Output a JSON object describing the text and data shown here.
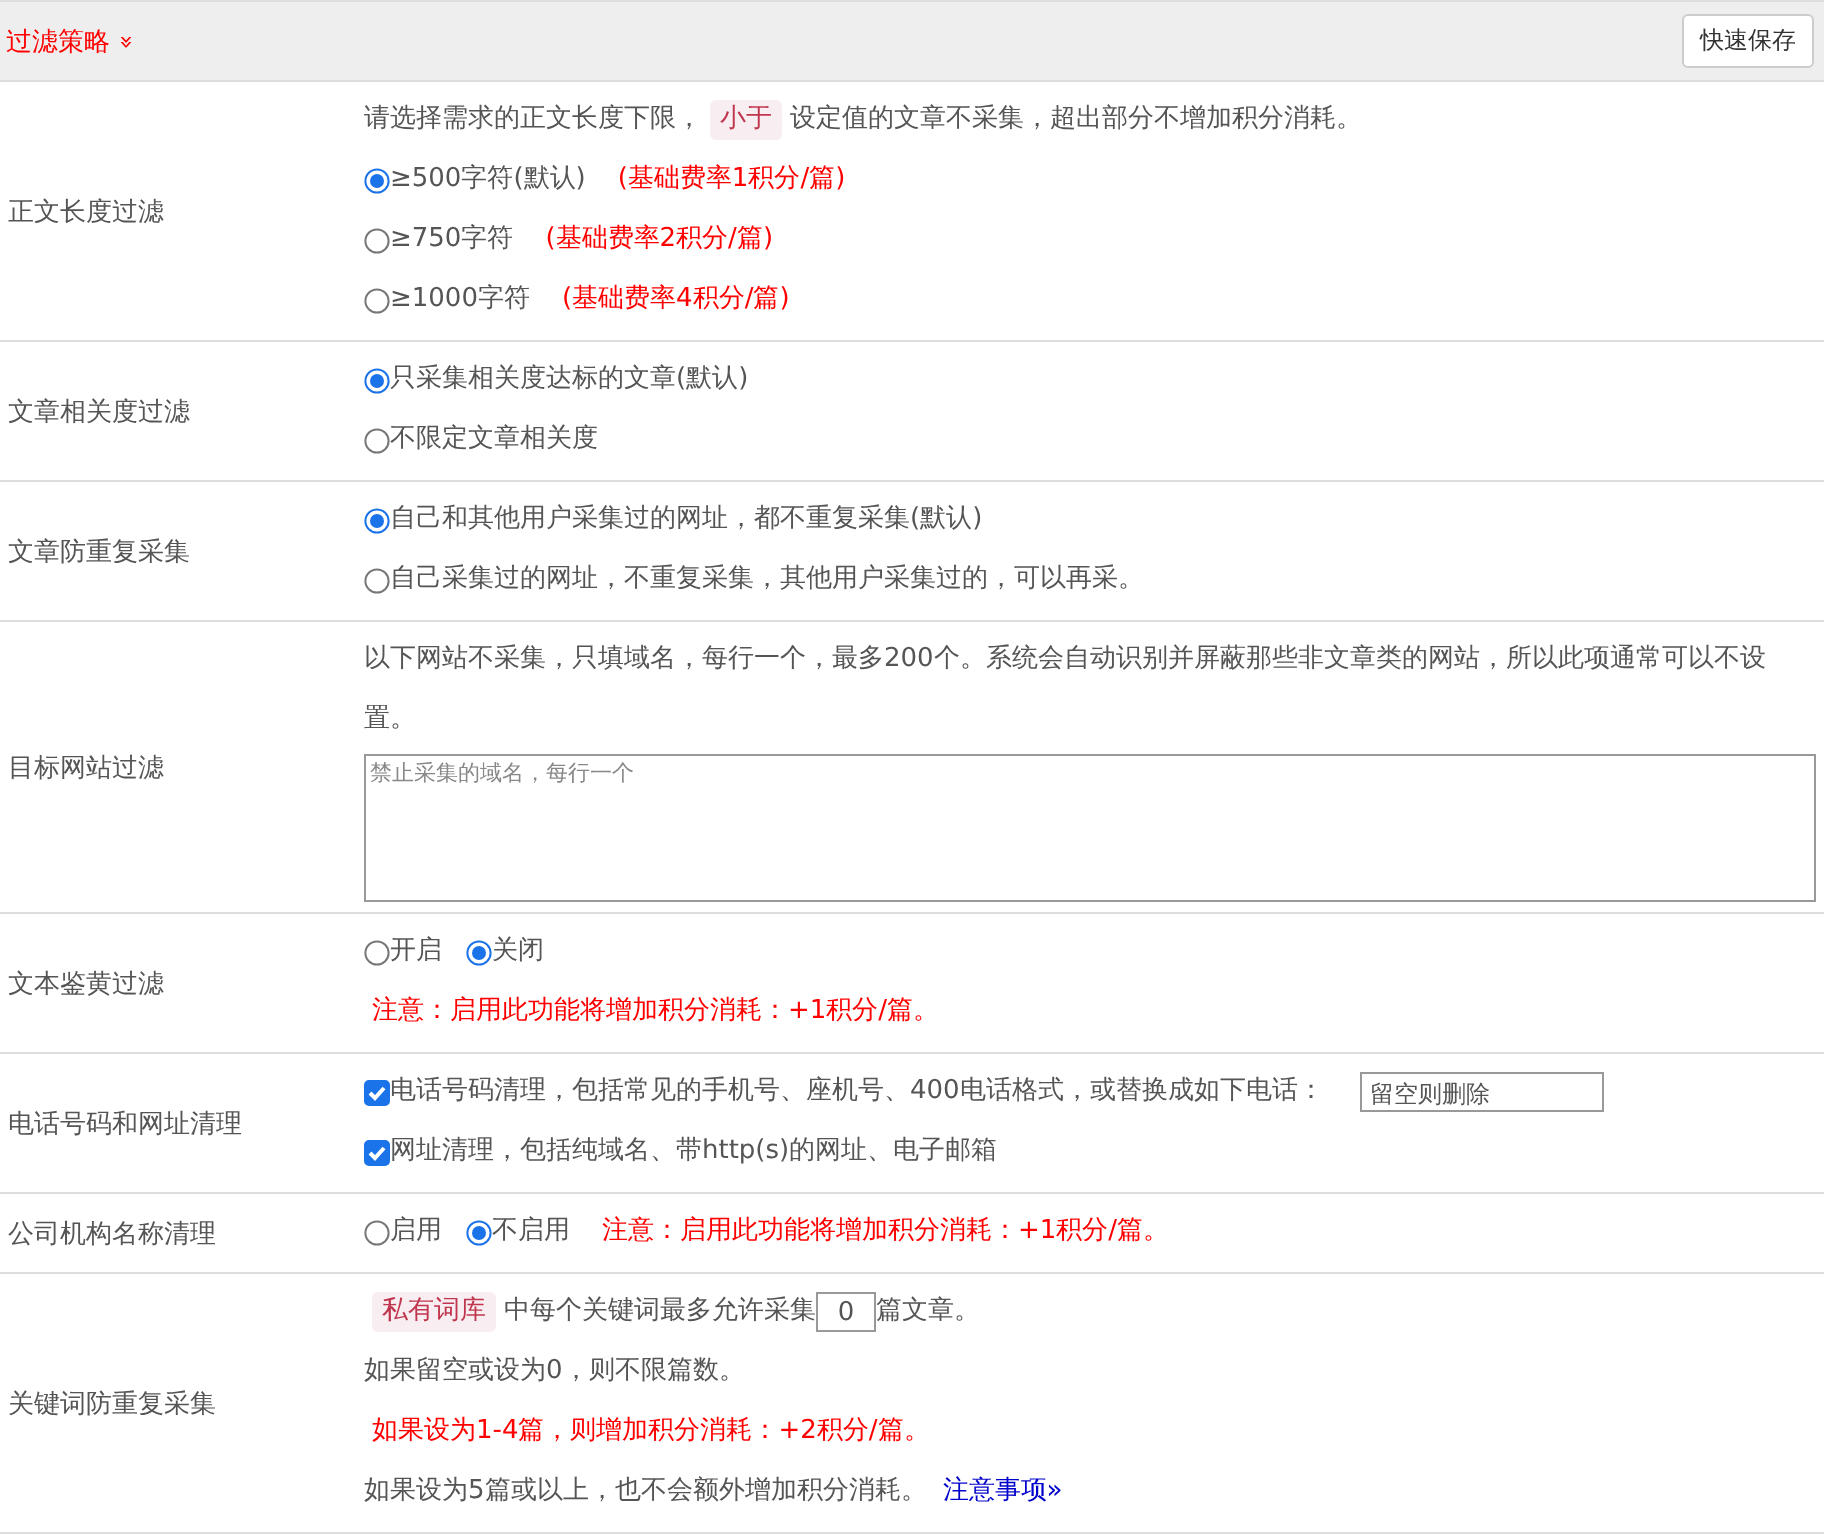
{
  "header": {
    "title": "过滤策略",
    "toggle": "»",
    "save_button": "快速保存"
  },
  "rows": [
    {
      "label": "正文长度过滤",
      "lines": [
        [
          {
            "kind": "text",
            "text": "请选择需求的正文长度下限，"
          },
          {
            "kind": "tag",
            "text": "小于"
          },
          {
            "kind": "text",
            "text": "设定值的文章不采集，超出部分不增加积分消耗。"
          }
        ],
        [
          {
            "kind": "radio",
            "text": "≥500字符(默认)",
            "selected": true
          },
          {
            "kind": "warning",
            "text": "(基础费率1积分/篇)"
          }
        ],
        [
          {
            "kind": "radio",
            "text": "≥750字符",
            "selected": false
          },
          {
            "kind": "warning",
            "text": "(基础费率2积分/篇)"
          }
        ],
        [
          {
            "kind": "radio",
            "text": "≥1000字符",
            "selected": false
          },
          {
            "kind": "warning",
            "text": "(基础费率4积分/篇)"
          }
        ]
      ]
    },
    {
      "label": "文章相关度过滤",
      "lines": [
        [
          {
            "kind": "radio",
            "text": "只采集相关度达标的文章(默认)",
            "selected": true
          }
        ],
        [
          {
            "kind": "radio",
            "text": "不限定文章相关度",
            "selected": false
          }
        ]
      ]
    },
    {
      "label": "文章防重复采集",
      "lines": [
        [
          {
            "kind": "radio",
            "text": "自己和其他用户采集过的网址，都不重复采集(默认)",
            "selected": true
          }
        ],
        [
          {
            "kind": "radio",
            "text": "自己采集过的网址，不重复采集，其他用户采集过的，可以再采。",
            "selected": false
          }
        ]
      ]
    },
    {
      "label": "目标网站过滤",
      "lines": [
        [
          {
            "kind": "text",
            "text": "以下网站不采集，只填域名，每行一个，最多200个。系统会自动识别并屏蔽那些非文章类的网站，所以此项通常可以不设置。"
          }
        ],
        [
          {
            "kind": "textarea",
            "placeholder": "禁止采集的域名，每行一个"
          }
        ]
      ]
    },
    {
      "label": "文本鉴黄过滤",
      "lines": [
        [
          {
            "kind": "radio",
            "text": "开启",
            "selected": false
          },
          {
            "kind": "radio",
            "text": "关闭",
            "selected": true
          }
        ],
        [
          {
            "kind": "warning",
            "text": "注意：启用此功能将增加积分消耗：+1积分/篇。"
          }
        ]
      ]
    },
    {
      "label": "电话号码和网址清理",
      "lines": [
        [
          {
            "kind": "checkbox",
            "text": "电话号码清理，包括常见的手机号、座机号、400电话格式，或替换成如下电话：",
            "checked": true
          },
          {
            "kind": "input",
            "placeholder": "留空则删除"
          }
        ],
        [
          {
            "kind": "checkbox",
            "text": "网址清理，包括纯域名、带http(s)的网址、电子邮箱",
            "checked": true
          }
        ]
      ]
    },
    {
      "label": "公司机构名称清理",
      "lines": [
        [
          {
            "kind": "radio",
            "text": "启用",
            "selected": false
          },
          {
            "kind": "radio",
            "text": "不启用",
            "selected": true
          },
          {
            "kind": "warning",
            "text": "注意：启用此功能将增加积分消耗：+1积分/篇。"
          }
        ]
      ]
    },
    {
      "label": "关键词防重复采集",
      "lines": [
        [
          {
            "kind": "tag",
            "text": "私有词库"
          },
          {
            "kind": "text",
            "text": "中每个关键词最多允许采集"
          },
          {
            "kind": "number",
            "value": "0"
          },
          {
            "kind": "text",
            "text": "篇文章。"
          }
        ],
        [
          {
            "kind": "text",
            "text": "如果留空或设为0，则不限篇数。"
          }
        ],
        [
          {
            "kind": "warning",
            "text": "如果设为1-4篇，则增加积分消耗：+2积分/篇。"
          }
        ],
        [
          {
            "kind": "text",
            "text": "如果设为5篇或以上，也不会额外增加积分消耗。"
          },
          {
            "kind": "link",
            "text": "注意事项»"
          }
        ]
      ]
    }
  ]
}
